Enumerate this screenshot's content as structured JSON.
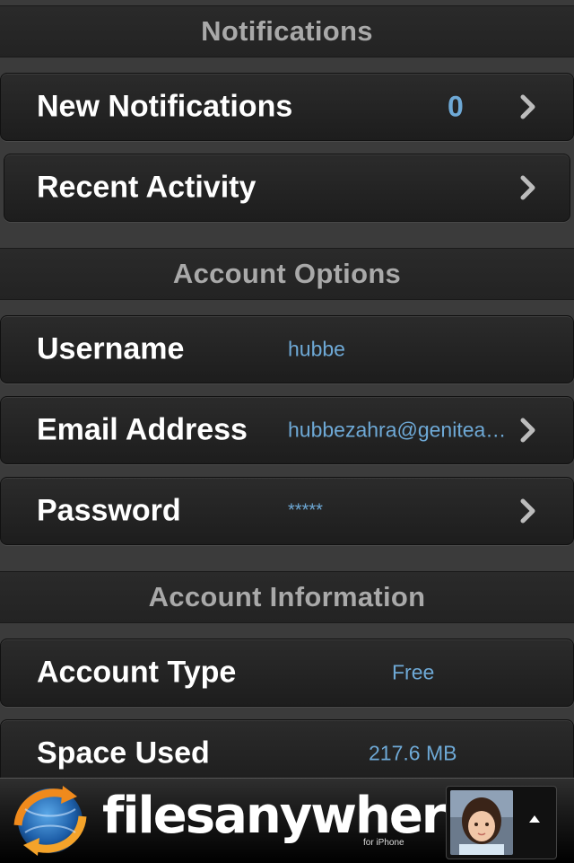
{
  "sections": {
    "notifications": {
      "header": "Notifications",
      "new_notifications": {
        "label": "New Notifications",
        "count": "0"
      },
      "recent_activity": {
        "label": "Recent Activity"
      }
    },
    "account_options": {
      "header": "Account Options",
      "username": {
        "label": "Username",
        "value": "hubbe"
      },
      "email": {
        "label": "Email Address",
        "value": "hubbezahra@genitea…"
      },
      "password": {
        "label": "Password",
        "value": "*****"
      }
    },
    "account_information": {
      "header": "Account Information",
      "account_type": {
        "label": "Account Type",
        "value": "Free"
      },
      "space_used": {
        "label": "Space Used",
        "value": "217.6 MB"
      }
    }
  },
  "bottom_bar": {
    "brand": "filesanywhere",
    "brand_sub": "for iPhone",
    "logo_icon": "globe-arrows-icon",
    "avatar_icon": "user-photo-avatar",
    "expand_icon": "triangle-up-icon"
  },
  "colors": {
    "value_blue": "#6ea9d6",
    "header_text": "#a9a9a9",
    "background": "#3b3b3b"
  }
}
